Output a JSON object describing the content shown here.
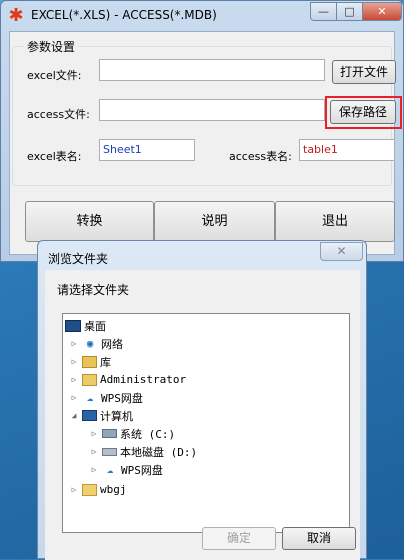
{
  "main_window": {
    "title": "EXCEL(*.XLS) - ACCESS(*.MDB)",
    "caption": {
      "min": "—",
      "max": "□",
      "close": "✕"
    },
    "group_title": "参数设置",
    "excel_label": "excel文件:",
    "excel_value": "",
    "open_button": "打开文件",
    "access_label": "access文件:",
    "access_value": "",
    "save_button": "保存路径",
    "excel_sheet_label": "excel表名:",
    "excel_sheet_value": "Sheet1",
    "access_table_label": "access表名:",
    "access_table_value": "table1",
    "convert_button": "转换",
    "help_button": "说明",
    "exit_button": "退出",
    "colors": {
      "highlight": "#e8202a",
      "sheet_text": "#1a3fb8",
      "table_text": "#c21b1b"
    }
  },
  "dialog": {
    "title": "浏览文件夹",
    "close": "✕",
    "prompt": "请选择文件夹",
    "tree": [
      {
        "label": "桌面",
        "icon": "desktop-icon",
        "arrow": ""
      },
      {
        "label": "网络",
        "icon": "network-icon",
        "arrow": "▷"
      },
      {
        "label": "库",
        "icon": "library-icon",
        "arrow": "▷"
      },
      {
        "label": "Administrator",
        "icon": "user-folder-icon",
        "arrow": "▷"
      },
      {
        "label": "WPS网盘",
        "icon": "cloud-icon",
        "arrow": "▷"
      },
      {
        "label": "计算机",
        "icon": "computer-icon",
        "arrow": "◢"
      },
      {
        "label": "系统 (C:)",
        "icon": "system-drive-icon",
        "arrow": "▷"
      },
      {
        "label": "本地磁盘 (D:)",
        "icon": "disk-icon",
        "arrow": "▷"
      },
      {
        "label": "WPS网盘",
        "icon": "cloud-icon",
        "arrow": "▷"
      },
      {
        "label": "wbgj",
        "icon": "folder-icon",
        "arrow": "▷"
      }
    ],
    "ok_button": "确定",
    "cancel_button": "取消"
  }
}
